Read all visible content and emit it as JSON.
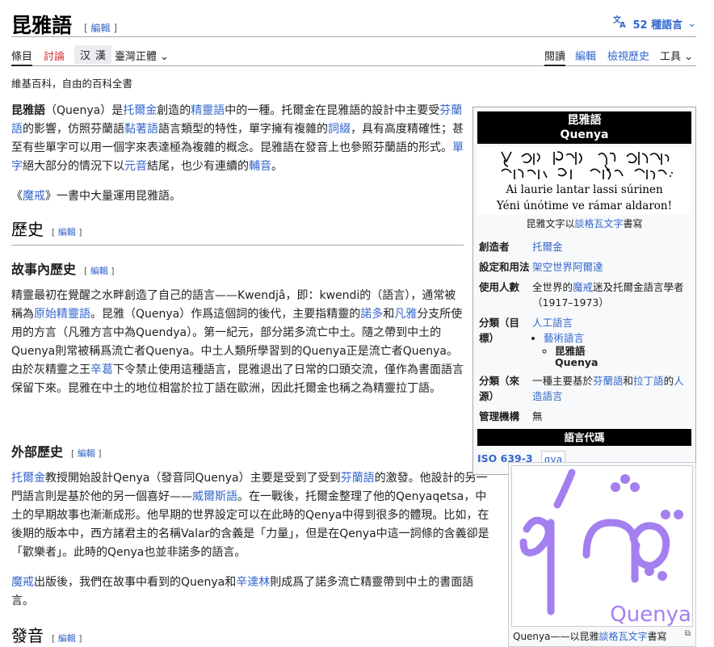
{
  "header": {
    "title": "昆雅語",
    "edit_label": "編輯",
    "lang_count": "52 種語言",
    "lang_icon": "translate-icon"
  },
  "tabs": {
    "article": "條目",
    "talk": "討論",
    "variant_hans": "汉",
    "variant_hant": "漢",
    "variant_tw": "臺灣正體",
    "read": "閱讀",
    "edit": "編輯",
    "history": "檢視歷史",
    "tools": "工具"
  },
  "tagline": "維基百科，自由的百科全書",
  "intro": {
    "p1": [
      "昆雅語",
      "（Quenya）是",
      "托爾金",
      "創造的",
      "精靈語",
      "中的一種。托爾金在昆雅語的設計中主要受",
      "芬蘭語",
      "的影響，仿照芬蘭語",
      "黏著語",
      "語言類型的特性，單字擁有複雜的",
      "詞綴",
      "，具有高度精確性；甚至有些單字可以用一個字來表達極為複雜的概念。昆雅語在發音上也參照芬蘭語的形式。",
      "單字",
      "絕大部分的情況下以",
      "元音",
      "結尾，也少有連續的",
      "輔音",
      "。"
    ],
    "p2": [
      "《",
      "魔戒",
      "》一書中大量運用昆雅語。"
    ]
  },
  "sections": {
    "history": "歷史",
    "internal": "故事內歷史",
    "external": "外部歷史",
    "phonology": "發音"
  },
  "internal_text": [
    "精靈最初在覺醒之水畔創造了自己的語言——Kwendjâ，即：kwendi的（語言），通常被稱為",
    "原始精靈語",
    "。昆雅（Quenya）作爲這個詞的後代，主要指精靈的",
    "諾多",
    "和",
    "凡雅",
    "分支所使用的方言（凡雅方言中為Quendya）。第一紀元，部分諾多流亡中土。隨之帶到中土的Quenya則常被稱爲流亡者Quenya。中土人類所學習到的Quenya正是流亡者Quenya。由於灰精靈之王",
    "辛葛",
    "下令禁止使用這種語言，昆雅退出了日常的口頭交流，僅作為書面語言保留下來。昆雅在中土的地位相當於拉丁語在歐洲，因此托爾金也稱之為精靈拉丁語。"
  ],
  "external_text": {
    "p1": [
      "托爾金",
      "教授開始設計Qenya（發音同Quenya）主要是受到了受到",
      "芬蘭語",
      "的激發。他設計的另一門語言則是基於他的另一個喜好——",
      "威爾斯語",
      "。在一戰後，托爾金整理了他的Qenyaqetsa，中土的早期故事也漸漸成形。他早期的世界設定可以在此時的Qenya中得到很多的體現。比如，在後期的版本中，西方諸君主的名稱Valar的含義是「力量」，但是在Qenya中這一詞條的含義卻是「歡樂者」。此時的Qenya也並非諾多的語言。"
    ],
    "p2": [
      "魔戒",
      "出版後，我們在故事中看到的Quenya和",
      "辛達林",
      "則成爲了諾多流亡精靈帶到中土的書面語言。"
    ]
  },
  "infobox": {
    "title1": "昆雅語",
    "title2": "Quenya",
    "tengwar_line1": "ᚼ ძϭಕ ᡥᠠᡡ ᢒᡃ ᠿᡫᡠᡵ",
    "tengwar_line2": "ᡥᡢ ᡝᠶᡲ ᡦ ᡤᡠᡡ ᠸᡬᡮ",
    "latin_line1": "Ai laurie lantar lassi súrinen",
    "latin_line2": "Yéni únótime ve rámar aldaron!",
    "caption": [
      "昆雅文字以",
      "談格瓦文字",
      "書寫"
    ],
    "rows": [
      {
        "label": "創造者",
        "value": "托爾金"
      },
      {
        "label": "設定和用法",
        "value": "架空世界阿爾達"
      },
      {
        "label": "使用人數",
        "value": [
          "全世界的",
          "魔戒",
          "迷及托爾金語言學者（1917–1973）"
        ]
      },
      {
        "label": "分類（目標）",
        "value": [
          "人工語言",
          "藝術語言",
          "昆雅語",
          "Quenya"
        ]
      },
      {
        "label": "分類（來源）",
        "value": [
          "一種主要基於",
          "芬蘭語",
          "和",
          "拉丁語",
          "的",
          "人造語言"
        ]
      },
      {
        "label": "管理機構",
        "value": "無"
      }
    ],
    "code_header": "語言代碼",
    "iso_label": "ISO 639-3",
    "iso_value": "qya"
  },
  "thumb": {
    "word": "Quenya",
    "caption": [
      "Quenya——以昆雅",
      "談格瓦文字",
      "書寫"
    ]
  },
  "colors": {
    "link": "#3366cc",
    "redlink": "#d73333",
    "tengwar_purple": "#a47ff0"
  }
}
